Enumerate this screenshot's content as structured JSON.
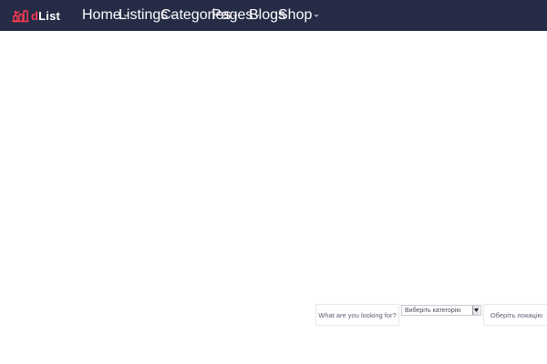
{
  "brand": {
    "logo_prefix": "d",
    "logo_rest": "List",
    "colors": {
      "header_bg": "#262b46",
      "accent": "#ff3b53",
      "nav_text": "#ffffff"
    }
  },
  "nav": {
    "items": [
      {
        "label": "Home",
        "has_dropdown": true,
        "icon": "chevron-down-icon"
      },
      {
        "label": "Listings",
        "has_dropdown": true,
        "icon": "chevron-down-icon"
      },
      {
        "label": "Categories",
        "has_dropdown": true,
        "icon": "chevron-down-icon"
      },
      {
        "label": "Pages",
        "has_dropdown": true,
        "icon": "chevron-down-icon"
      },
      {
        "label": "Blogs",
        "has_dropdown": false
      },
      {
        "label": "Shop",
        "has_dropdown": true,
        "icon": "chevron-down-icon"
      }
    ]
  },
  "search": {
    "keyword_placeholder": "What are you looking for?",
    "category_selected": "Виберіть категорію",
    "location_placeholder": "Оберіть локацію"
  }
}
